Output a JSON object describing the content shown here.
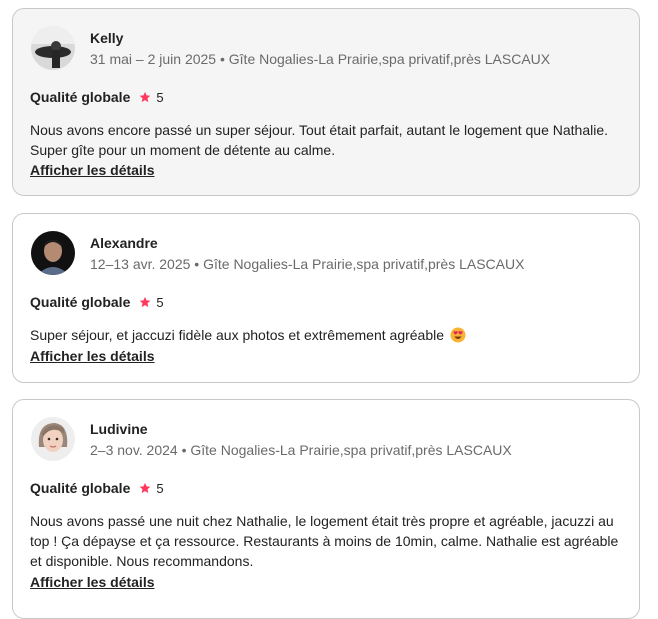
{
  "reviews": [
    {
      "name": "Kelly",
      "meta": "31 mai – 2 juin 2025 • Gîte Nogalies-La Prairie,spa privatif,près LASCAUX",
      "rating_label": "Qualité globale",
      "rating_value": "5",
      "text": "Nous avons encore passé un super séjour. Tout était parfait, autant le logement que Nathalie. Super gîte pour un moment de détente au calme.",
      "details_label": "Afficher les détails"
    },
    {
      "name": "Alexandre",
      "meta": "12–13 avr. 2025 • Gîte Nogalies-La Prairie,spa privatif,près LASCAUX",
      "rating_label": "Qualité globale",
      "rating_value": "5",
      "text": "Super séjour, et jaccuzi fidèle aux photos et extrêmement agréable",
      "details_label": "Afficher les détails"
    },
    {
      "name": "Ludivine",
      "meta": "2–3 nov. 2024 • Gîte Nogalies-La Prairie,spa privatif,près LASCAUX",
      "rating_label": "Qualité globale",
      "rating_value": "5",
      "text": "Nous avons passé une nuit chez Nathalie, le logement était très propre et agréable, jacuzzi au top ! Ça dépayse et ça ressource. Restaurants à moins de 10min, calme. Nathalie est agréable et disponible. Nous recommandons.",
      "details_label": "Afficher les détails"
    }
  ],
  "icons": {
    "star": "star-icon",
    "emoji": "heart-eyes-emoji-icon"
  },
  "colors": {
    "star": "#ff385c",
    "border": "#c8c8c8",
    "hover_bg": "#f5f5f5",
    "meta_text": "#6a6a6a"
  }
}
